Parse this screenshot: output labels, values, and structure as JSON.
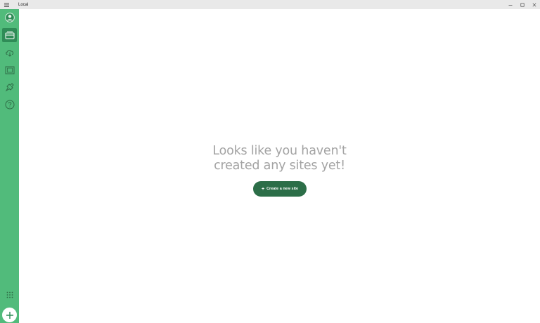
{
  "window": {
    "title": "Local"
  },
  "sidebar": {
    "items": [
      {
        "name": "account",
        "icon": "user-circle-icon",
        "active": false
      },
      {
        "name": "sites",
        "icon": "sites-icon",
        "active": true
      },
      {
        "name": "connect",
        "icon": "cloud-download-icon",
        "active": false
      },
      {
        "name": "blueprints",
        "icon": "blueprint-icon",
        "active": false
      },
      {
        "name": "addons",
        "icon": "puzzle-icon",
        "active": false
      },
      {
        "name": "help",
        "icon": "help-circle-icon",
        "active": false
      }
    ],
    "apps_icon": "grid-dots-icon",
    "add_icon": "plus-icon"
  },
  "empty_state": {
    "line1": "Looks like you haven't",
    "line2": "created any sites yet!",
    "button_plus": "+",
    "button_label": "Create a new site"
  },
  "colors": {
    "sidebar": "#51bb7b",
    "sidebar_active": "#2f8c57",
    "button": "#2c6e48",
    "text_muted": "#a3a3a3"
  }
}
